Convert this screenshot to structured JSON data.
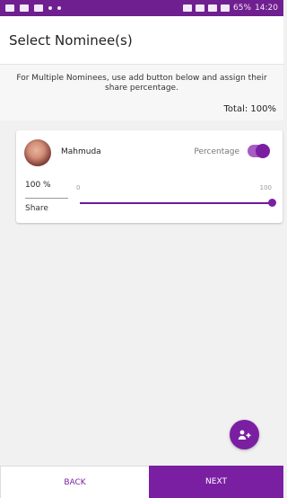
{
  "status": {
    "battery": "65%",
    "time": "14:20"
  },
  "header": {
    "title": "Select Nominee(s)"
  },
  "info": {
    "text": "For Multiple Nominees, use add button below and assign their share percentage.",
    "total": "Total: 100%"
  },
  "nominee": {
    "name": "Mahmuda",
    "percentage_label": "Percentage",
    "share_value": "100 %",
    "share_label": "Share",
    "slider_min": "0",
    "slider_max": "100",
    "slider_fraction": 1,
    "toggle_on": true
  },
  "footer": {
    "back_label": "BACK",
    "next_label": "NEXT"
  },
  "colors": {
    "accent": "#7b1fa2",
    "status_bar": "#6f1f8f"
  },
  "icons": {
    "avatar": "avatar-icon",
    "fab": "add-user-icon"
  }
}
